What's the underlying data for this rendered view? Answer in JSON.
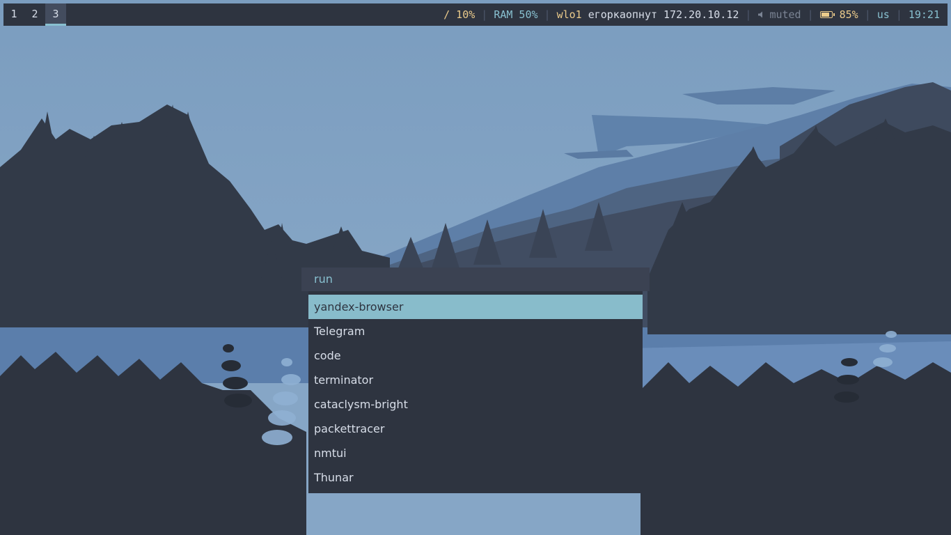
{
  "colors": {
    "background": "#2e3440",
    "accent": "#88c0d0",
    "warning": "#ebcb8b",
    "selection": "#88bccb",
    "muted": "#7b8494"
  },
  "workspaces": [
    {
      "label": "1",
      "active": false
    },
    {
      "label": "2",
      "active": false
    },
    {
      "label": "3",
      "active": true
    }
  ],
  "status": {
    "disk": "/ 10%",
    "ram": "RAM 50%",
    "wifi_iface": "wlo1",
    "wifi_ssid": "егоркаопнут",
    "wifi_ip": "172.20.10.12",
    "volume_icon": "speaker-icon",
    "volume": "muted",
    "battery_icon": "battery-icon",
    "battery": "85%",
    "battery_level": 0.85,
    "keyboard_layout": "us",
    "time": "19:21"
  },
  "launcher": {
    "prompt": "run",
    "selected_index": 0,
    "items": [
      "yandex-browser",
      "Telegram",
      "code",
      "terminator",
      "cataclysm-bright",
      "packettracer",
      "nmtui",
      "Thunar"
    ]
  }
}
